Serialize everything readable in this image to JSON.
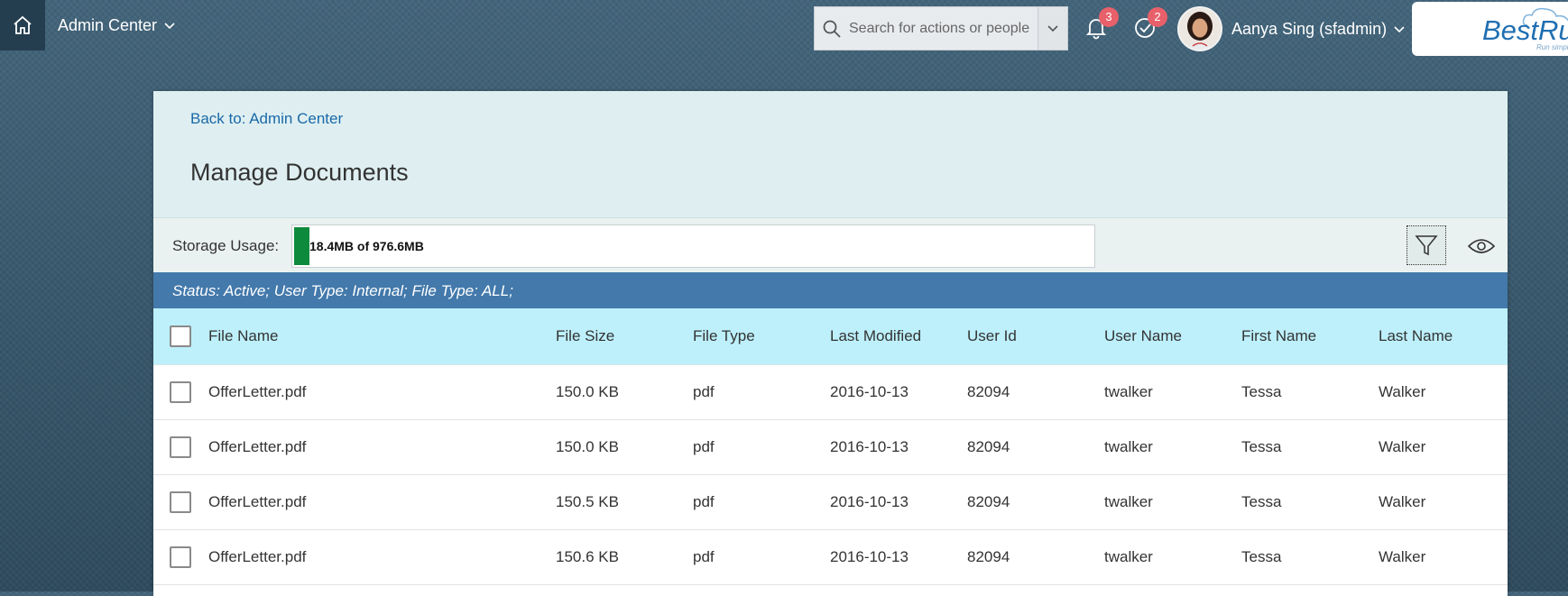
{
  "shell": {
    "module_title": "Admin Center",
    "search_placeholder": "Search for actions or people",
    "notifications_count": "3",
    "todo_count": "2",
    "user_name": "Aanya Sing (sfadmin)",
    "logo_text": "BestRu",
    "logo_tagline": "Run simple"
  },
  "header": {
    "back_link": "Back to: Admin Center",
    "title": "Manage Documents"
  },
  "storage": {
    "label": "Storage Usage:",
    "usage_text": "18.4MB of 976.6MB",
    "used_fraction": 0.0188
  },
  "status_filter": "Status: Active; User Type: Internal; File Type: ALL;",
  "table": {
    "columns": [
      "File Name",
      "File Size",
      "File Type",
      "Last Modified",
      "User Id",
      "User Name",
      "First Name",
      "Last Name"
    ],
    "rows": [
      [
        "OfferLetter.pdf",
        "150.0 KB",
        "pdf",
        "2016-10-13",
        "82094",
        "twalker",
        "Tessa",
        "Walker"
      ],
      [
        "OfferLetter.pdf",
        "150.0 KB",
        "pdf",
        "2016-10-13",
        "82094",
        "twalker",
        "Tessa",
        "Walker"
      ],
      [
        "OfferLetter.pdf",
        "150.5 KB",
        "pdf",
        "2016-10-13",
        "82094",
        "twalker",
        "Tessa",
        "Walker"
      ],
      [
        "OfferLetter.pdf",
        "150.6 KB",
        "pdf",
        "2016-10-13",
        "82094",
        "twalker",
        "Tessa",
        "Walker"
      ]
    ]
  },
  "colors": {
    "accent_blue": "#4379ab",
    "header_cyan": "#bdf0fb",
    "storage_green": "#0e8a3c",
    "badge_red": "#e8606a"
  },
  "icons": [
    "home-icon",
    "chevron-down-icon",
    "search-icon",
    "bell-icon",
    "checkmark-circle-icon",
    "filter-icon",
    "eye-icon"
  ]
}
